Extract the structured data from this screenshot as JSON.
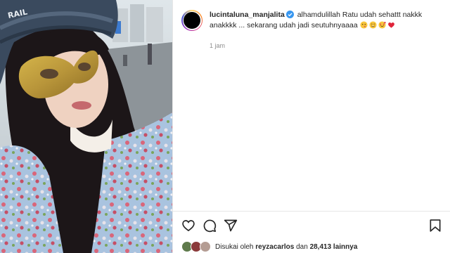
{
  "post": {
    "username": "lucintaluna_manjalita",
    "verified": true,
    "caption_line1": "alhamdulillah Ratu udah sehattt nakkk",
    "caption_line2": "anakkkk ... sekarang udah jadi seutuhnyaaaa",
    "caption_emojis": [
      "face-emoji",
      "smiling-face-emoji",
      "smiling-face-with-hearts-emoji",
      "red-heart-emoji"
    ],
    "timestamp": "1 jam"
  },
  "media": {
    "description_icon": "selfie-photo",
    "hat_text": "RAIL"
  },
  "actions": {
    "icons": [
      "heart-icon",
      "comment-icon",
      "share-icon",
      "bookmark-icon"
    ]
  },
  "likes": {
    "prefix": "Disukai oleh",
    "user": "reyzacarlos",
    "connector": "dan",
    "others": "28,413 lainnya"
  },
  "colors": {
    "text": "#262626",
    "secondary": "#8e8e8e",
    "verified": "#3897f0",
    "border": "#e6e6e6"
  }
}
